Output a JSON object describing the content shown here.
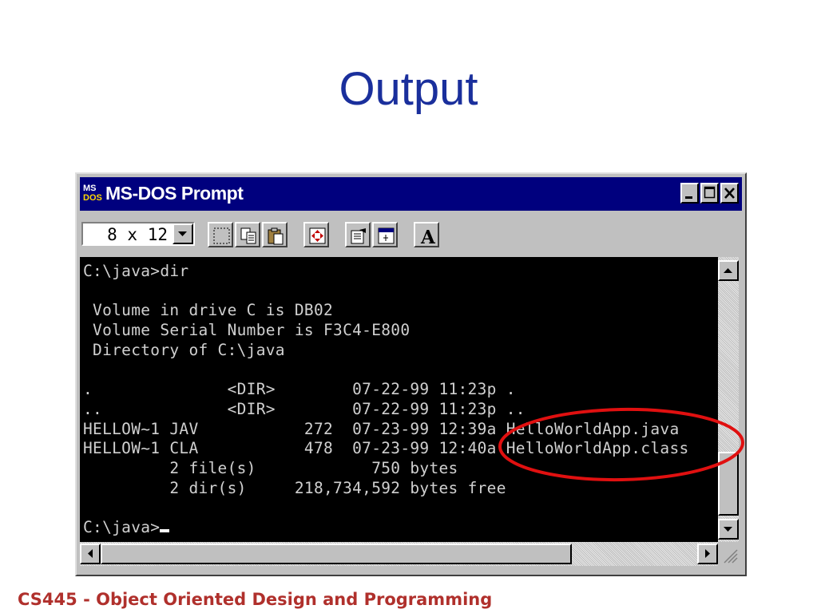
{
  "slide": {
    "title": "Output",
    "footer": "CS445 - Object Oriented Design and Programming"
  },
  "window": {
    "title": "MS-DOS Prompt",
    "icon_text_top": "MS",
    "icon_text_bottom": "DOS",
    "controls": {
      "minimize": "_",
      "maximize": "□",
      "close": "✕"
    }
  },
  "toolbar": {
    "font_size": "8 x 12",
    "tools": [
      "mark-icon",
      "copy-icon",
      "paste-icon",
      "fullscreen-icon",
      "properties-icon",
      "background-icon",
      "font-icon"
    ],
    "font_button_label": "A"
  },
  "console": {
    "lines": [
      "C:\\java>dir",
      "",
      " Volume in drive C is DB02",
      " Volume Serial Number is F3C4-E800",
      " Directory of C:\\java",
      "",
      ".              <DIR>        07-22-99 11:23p .",
      "..             <DIR>        07-22-99 11:23p ..",
      "HELLOW~1 JAV           272  07-23-99 12:39a HelloWorldApp.java",
      "HELLOW~1 CLA           478  07-23-99 12:40a HelloWorldApp.class",
      "         2 file(s)            750 bytes",
      "         2 dir(s)     218,734,592 bytes free",
      "",
      "C:\\java>"
    ]
  },
  "annotation": {
    "color": "#e01010",
    "shape": "ellipse"
  }
}
